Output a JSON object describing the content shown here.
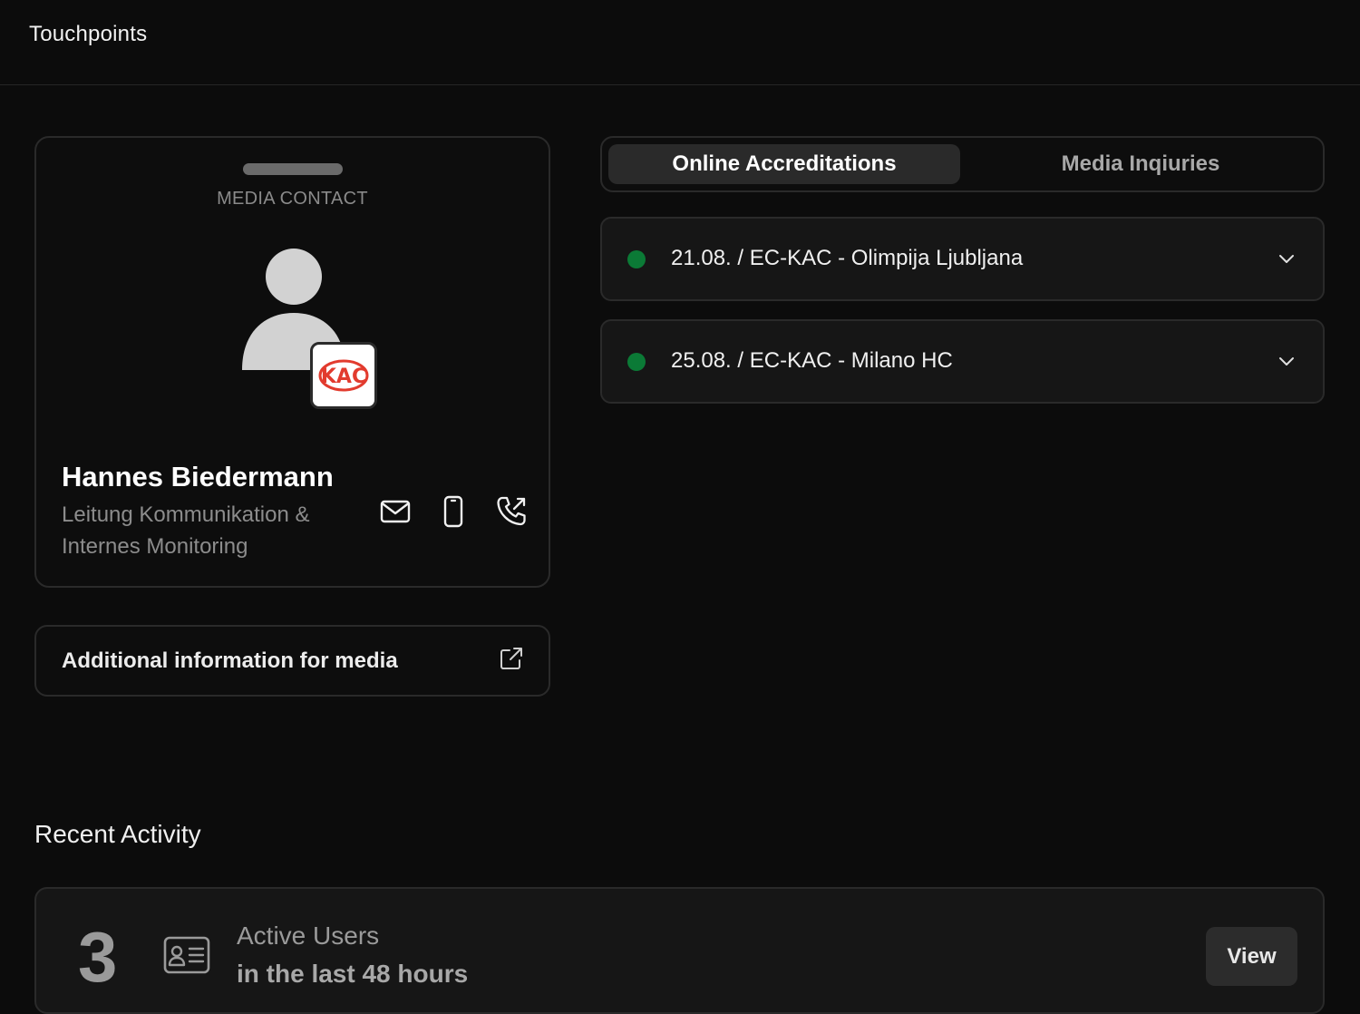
{
  "header": {
    "title": "Touchpoints"
  },
  "contact": {
    "section_label": "MEDIA CONTACT",
    "name": "Hannes Biedermann",
    "role": "Leitung Kommunikation & Internes Monitoring",
    "badge_text": "KAC",
    "actions": [
      "mail-icon",
      "mobile-phone-icon",
      "phone-outgoing-icon"
    ]
  },
  "info_link": {
    "label": "Additional information for media"
  },
  "tabs": [
    {
      "label": "Online Accreditations",
      "active": true
    },
    {
      "label": "Media Inqiuries",
      "active": false
    }
  ],
  "events": [
    {
      "label": "21.08. / EC-KAC - Olimpija Ljubljana",
      "status_color": "#0b7a36"
    },
    {
      "label": "25.08. / EC-KAC - Milano HC",
      "status_color": "#0b7a36"
    }
  ],
  "recent_activity": {
    "title": "Recent Activity",
    "count": "3",
    "label": "Active Users",
    "sublabel": "in the last 48 hours",
    "button": "View"
  }
}
